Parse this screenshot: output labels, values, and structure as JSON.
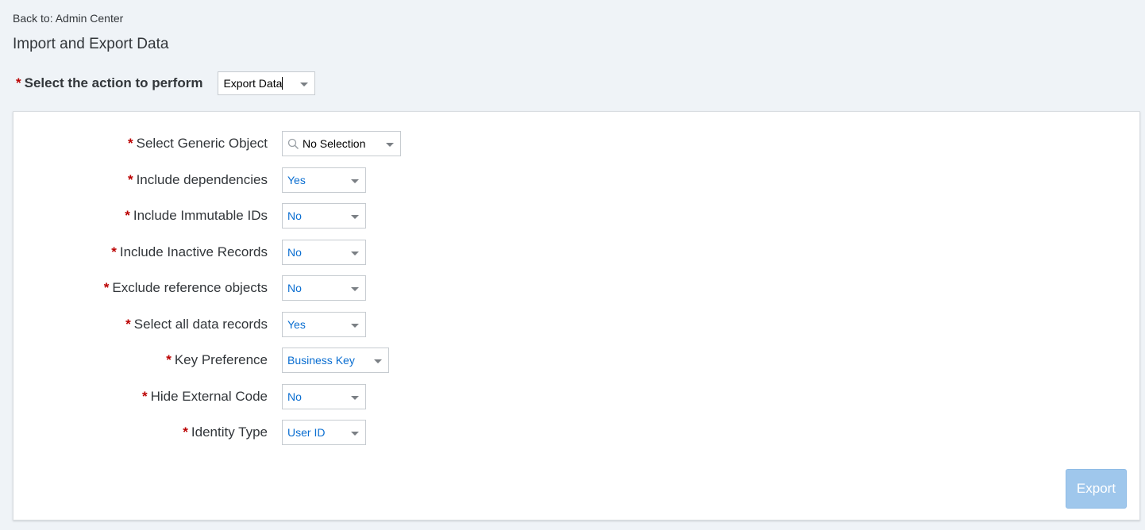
{
  "nav": {
    "back_label": "Back to: Admin Center"
  },
  "page": {
    "title": "Import and Export Data"
  },
  "action": {
    "required_mark": "*",
    "label": "Select the action to perform",
    "value": "Export Data"
  },
  "form": {
    "fields": [
      {
        "label": "Select Generic Object",
        "value": "No Selection",
        "icon": "search-icon"
      },
      {
        "label": "Include dependencies",
        "value": "Yes"
      },
      {
        "label": "Include Immutable IDs",
        "value": "No"
      },
      {
        "label": "Include Inactive Records",
        "value": "No"
      },
      {
        "label": "Exclude reference objects",
        "value": "No"
      },
      {
        "label": "Select all data records",
        "value": "Yes"
      },
      {
        "label": "Key Preference",
        "value": "Business Key"
      },
      {
        "label": "Hide External Code",
        "value": "No"
      },
      {
        "label": "Identity Type",
        "value": "User ID"
      }
    ]
  },
  "buttons": {
    "export_label": "Export",
    "export_enabled": false
  },
  "colors": {
    "required": "#bb0000",
    "value_text": "#0a6ed1",
    "button_disabled": "#9fc7ec",
    "background": "#eff3f7"
  }
}
